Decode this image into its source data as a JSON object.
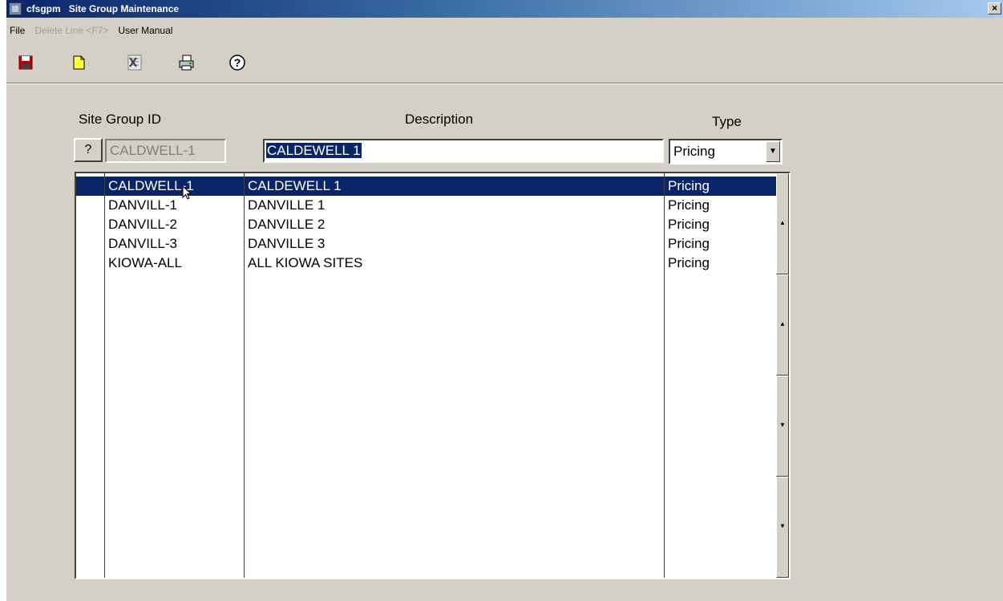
{
  "window": {
    "app_name": "cfsgpm",
    "title": "Site Group Maintenance",
    "close_label": "×"
  },
  "menu": {
    "file": "File",
    "delete_line": "Delete Line <F7>",
    "user_manual": "User Manual"
  },
  "toolbar": {
    "icons": [
      "save-icon",
      "new-icon",
      "delete-icon",
      "print-icon",
      "help-icon"
    ]
  },
  "form": {
    "site_group_id_label": "Site Group ID",
    "description_label": "Description",
    "type_label": "Type",
    "lookup_button": "?",
    "site_group_id_value": "CALDWELL-1",
    "description_value": "CALDEWELL 1",
    "type_value": "Pricing"
  },
  "grid": {
    "rows": [
      {
        "id": "CALDWELL-1",
        "description": "CALDEWELL 1",
        "type": "Pricing",
        "selected": true
      },
      {
        "id": "DANVILL-1",
        "description": "DANVILLE 1",
        "type": "Pricing",
        "selected": false
      },
      {
        "id": "DANVILL-2",
        "description": "DANVILLE 2",
        "type": "Pricing",
        "selected": false
      },
      {
        "id": "DANVILL-3",
        "description": "DANVILLE 3",
        "type": "Pricing",
        "selected": false
      },
      {
        "id": "KIOWA-ALL",
        "description": "ALL KIOWA SITES",
        "type": "Pricing",
        "selected": false
      }
    ]
  },
  "scrollbar": {
    "buttons": [
      "first-page",
      "page-up",
      "page-down",
      "last-page"
    ]
  },
  "colors": {
    "selection": "#0a246a",
    "window_bg": "#d4d0c8"
  }
}
